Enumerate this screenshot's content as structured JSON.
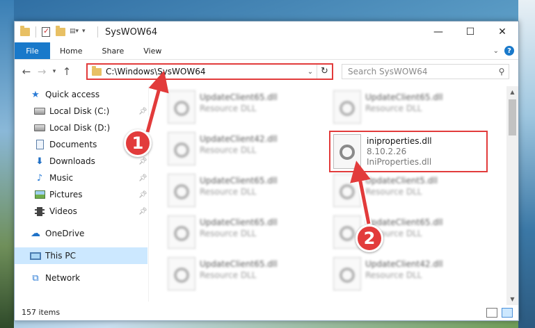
{
  "window": {
    "title": "SysWOW64"
  },
  "ribbon": {
    "tabs": [
      "File",
      "Home",
      "Share",
      "View"
    ]
  },
  "navbar": {
    "address": "C:\\Windows\\SysWOW64",
    "search_placeholder": "Search SysWOW64"
  },
  "sidebar": {
    "items": [
      {
        "label": "Quick access",
        "icon": "star-icon",
        "pinned": false
      },
      {
        "label": "Local Disk (C:)",
        "icon": "disk-icon",
        "pinned": true
      },
      {
        "label": "Local Disk (D:)",
        "icon": "disk-icon",
        "pinned": false
      },
      {
        "label": "Documents",
        "icon": "documents-icon",
        "pinned": true
      },
      {
        "label": "Downloads",
        "icon": "downloads-icon",
        "pinned": true
      },
      {
        "label": "Music",
        "icon": "music-icon",
        "pinned": true
      },
      {
        "label": "Pictures",
        "icon": "pictures-icon",
        "pinned": true
      },
      {
        "label": "Videos",
        "icon": "videos-icon",
        "pinned": true
      },
      {
        "label": "OneDrive",
        "icon": "onedrive-icon",
        "pinned": false
      },
      {
        "label": "This PC",
        "icon": "this-pc-icon",
        "pinned": false,
        "selected": true
      },
      {
        "label": "Network",
        "icon": "network-icon",
        "pinned": false
      }
    ]
  },
  "files": {
    "left": [
      {
        "name": "UpdateClient65.dll",
        "type": "Resource DLL"
      },
      {
        "name": "UpdateClient42.dll",
        "type": "Resource DLL"
      },
      {
        "name": "UpdateClient65.dll",
        "type": "Resource DLL"
      },
      {
        "name": "UpdateClient65.dll",
        "type": "Resource DLL"
      },
      {
        "name": "UpdateClient65.dll",
        "type": "Resource DLL"
      }
    ],
    "right": [
      {
        "name": "UpdateClient65.dll",
        "type": "Resource DLL"
      },
      {
        "name": "UpdateClient5.dll",
        "type": "Resource DLL"
      },
      {
        "name": "UpdateClient65.dll",
        "type": "Resource DLL"
      },
      {
        "name": "UpdateClient42.dll",
        "type": "Resource DLL"
      }
    ],
    "highlighted": {
      "name": "iniproperties.dll",
      "version": "8.10.2.26",
      "description": "IniProperties.dll"
    }
  },
  "status": {
    "item_count": "157 items"
  },
  "annotations": {
    "step1": "1",
    "step2": "2",
    "color": "#e23b3b"
  }
}
